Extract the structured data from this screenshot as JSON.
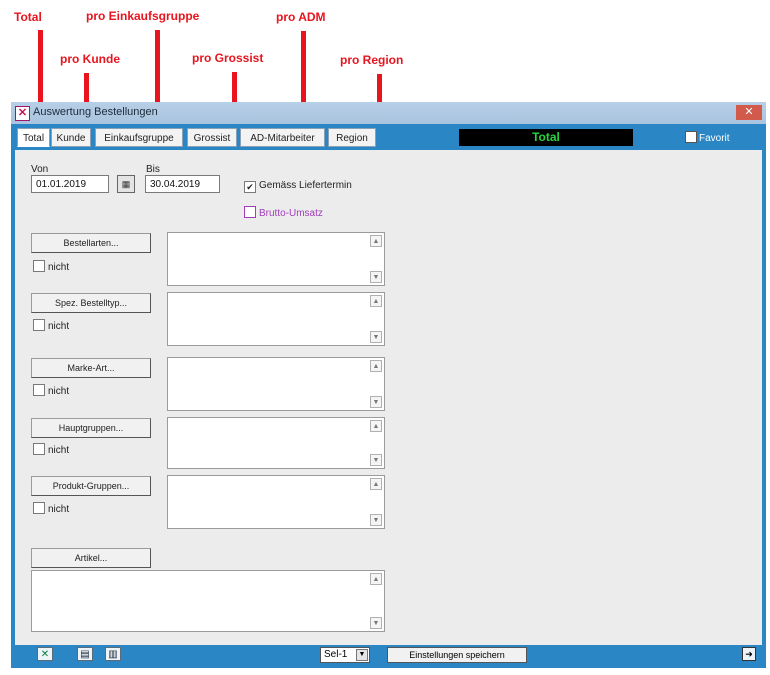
{
  "annotations": {
    "total": "Total",
    "pro_kunde": "pro Kunde",
    "pro_einkaufsgruppe": "pro Einkaufsgruppe",
    "pro_grossist": "pro Grossist",
    "pro_adm": "pro ADM",
    "pro_region": "pro Region"
  },
  "window": {
    "title": "Auswertung Bestellungen",
    "close_label": "✕"
  },
  "tabs": [
    {
      "label": "Total"
    },
    {
      "label": "Kunde"
    },
    {
      "label": "Einkaufsgruppe"
    },
    {
      "label": "Grossist"
    },
    {
      "label": "AD-Mitarbeiter"
    },
    {
      "label": "Region"
    }
  ],
  "total_display": "Total",
  "favorit_label": "Favorit",
  "filters": {
    "von_label": "Von",
    "von_value": "01.01.2019",
    "bis_label": "Bis",
    "bis_value": "30.04.2019",
    "calendar_icon": "calendar-icon",
    "gemaess_liefertermin": "Gemäss Liefertermin",
    "gemaess_checked": "✔",
    "brutto_umsatz": "Brutto-Umsatz"
  },
  "groups": [
    {
      "button": "Bestellarten...",
      "nicht": "nicht"
    },
    {
      "button": "Spez. Bestelltyp...",
      "nicht": "nicht"
    },
    {
      "button": "Marke-Art...",
      "nicht": "nicht"
    },
    {
      "button": "Hauptgruppen...",
      "nicht": "nicht"
    },
    {
      "button": "Produkt-Gruppen...",
      "nicht": "nicht"
    }
  ],
  "artikel_button": "Artikel...",
  "scroll_up": "▲",
  "scroll_down": "▼",
  "statusbar": {
    "select_value": "Sel-1",
    "save_label": "Einstellungen speichern",
    "icons": [
      "excel-icon",
      "preview-icon",
      "print-icon",
      "exit-icon"
    ]
  },
  "colors": {
    "annotation": "#e8141e",
    "window_blue": "#2a86c4",
    "total_bg": "#000000",
    "total_fg": "#27d33b"
  }
}
